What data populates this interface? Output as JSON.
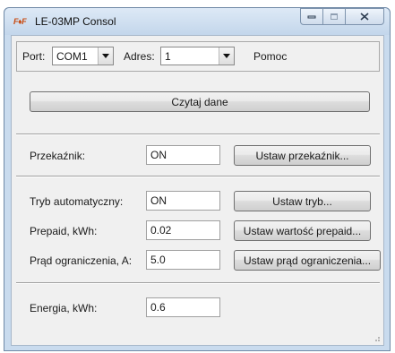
{
  "window": {
    "logo_text": "F♦F",
    "title": "LE-03MP Consol",
    "controls": [
      "minimize-icon",
      "maximize-icon",
      "close-icon"
    ]
  },
  "toolbar": {
    "port_label": "Port:",
    "port_value": "COM1",
    "address_label": "Adres:",
    "address_value": "1",
    "help_label": "Pomoc"
  },
  "read_button": "Czytaj dane",
  "rows": {
    "relay": {
      "label": "Przekaźnik:",
      "value": "ON",
      "button": "Ustaw przekaźnik..."
    },
    "auto_mode": {
      "label": "Tryb automatyczny:",
      "value": "ON",
      "button": "Ustaw tryb..."
    },
    "prepaid": {
      "label": "Prepaid, kWh:",
      "value": "0.02",
      "button": "Ustaw wartość prepaid..."
    },
    "current_limit": {
      "label": "Prąd ograniczenia, A:",
      "value": "5.0",
      "button": "Ustaw prąd ograniczenia..."
    },
    "energy": {
      "label": "Energia, kWh:",
      "value": "0.6"
    }
  },
  "colors": {
    "frame": "#c9dbee",
    "client": "#f0f0f0",
    "logo": "#c84a10"
  }
}
